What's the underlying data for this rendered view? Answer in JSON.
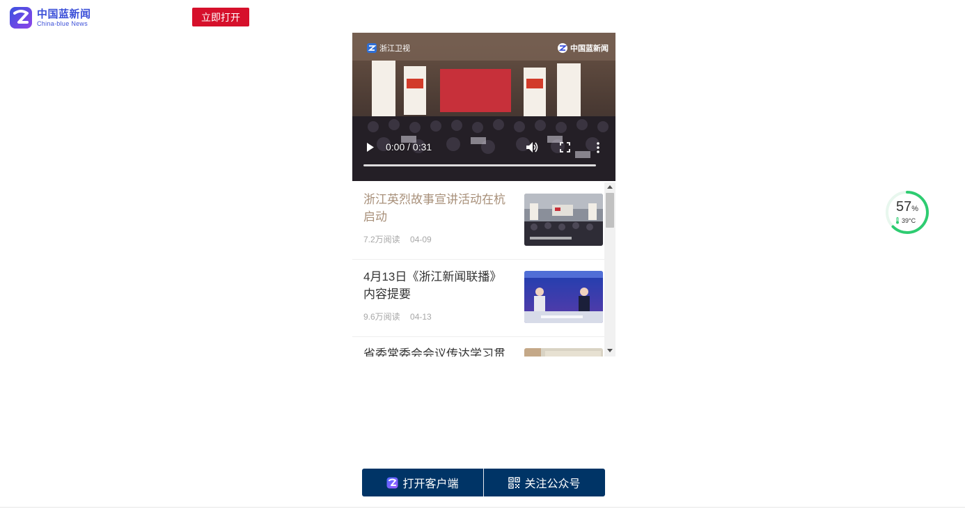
{
  "header": {
    "brand_cn": "中国蓝新闻",
    "brand_en": "China-blue News",
    "open_button": "立即打开"
  },
  "video": {
    "overlay_left": "浙江卫视",
    "overlay_right": "中国蓝新闻",
    "time": "0:00 / 0:31",
    "progress": 0
  },
  "news": [
    {
      "title": "浙江英烈故事宣讲活动在杭启动",
      "reads": "7.2万阅读",
      "date": "04-09",
      "visited": true
    },
    {
      "title": "4月13日《浙江新闻联播》内容提要",
      "reads": "9.6万阅读",
      "date": "04-13",
      "visited": false
    },
    {
      "title": "省委常委会会议传达学习贯",
      "reads": "",
      "date": "",
      "visited": false
    }
  ],
  "gauge": {
    "percent": "57",
    "unit": "%",
    "temp": "39°C"
  },
  "bottom": {
    "open_client": "打开客户端",
    "follow": "关注公众号"
  },
  "colors": {
    "brand_blue": "#3b4fd8",
    "open_red": "#d6102b",
    "bottom_navy": "#003466",
    "visited_title": "#a8907a",
    "gauge_green": "#2ecc71"
  }
}
